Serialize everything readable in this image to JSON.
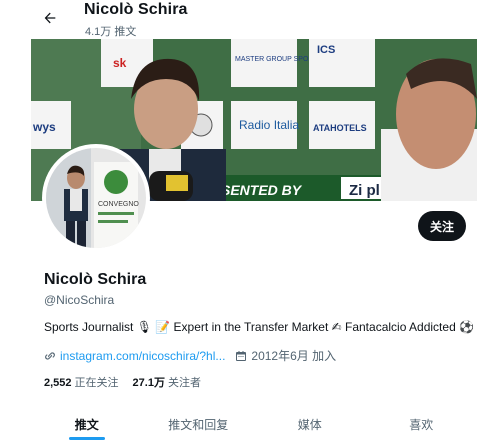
{
  "header": {
    "name": "Nicolò Schira",
    "post_count": "4.1万 推文",
    "back_icon": "arrow-left-icon"
  },
  "banner": {
    "signs": [
      "sk",
      "MASTER GROUP SPORT",
      "ICS",
      "Radio Italia",
      "ATAHOTELS",
      "wys",
      "SENTED BY",
      "Zi pl"
    ]
  },
  "avatar": {
    "sign_text": "CONVEGNO"
  },
  "profile": {
    "follow_label": "关注",
    "display_name": "Nicolò Schira",
    "handle": "@NicoSchira",
    "bio": "Sports Journalist 🎙 📝 Expert in the Transfer Market ✍ Fantacalcio Addicted ⚽",
    "link_text": "instagram.com/nicoschira/?hl...",
    "joined": "2012年6月 加入"
  },
  "stats": {
    "following_count": "2,552",
    "following_label": "正在关注",
    "followers_count": "27.1万",
    "followers_label": "关注者"
  },
  "tabs": [
    {
      "label": "推文",
      "active": true
    },
    {
      "label": "推文和回复",
      "active": false
    },
    {
      "label": "媒体",
      "active": false
    },
    {
      "label": "喜欢",
      "active": false
    }
  ],
  "colors": {
    "accent": "#1d9bf0",
    "text": "#0f1419",
    "secondary": "#536471",
    "button_bg": "#0f1419"
  }
}
